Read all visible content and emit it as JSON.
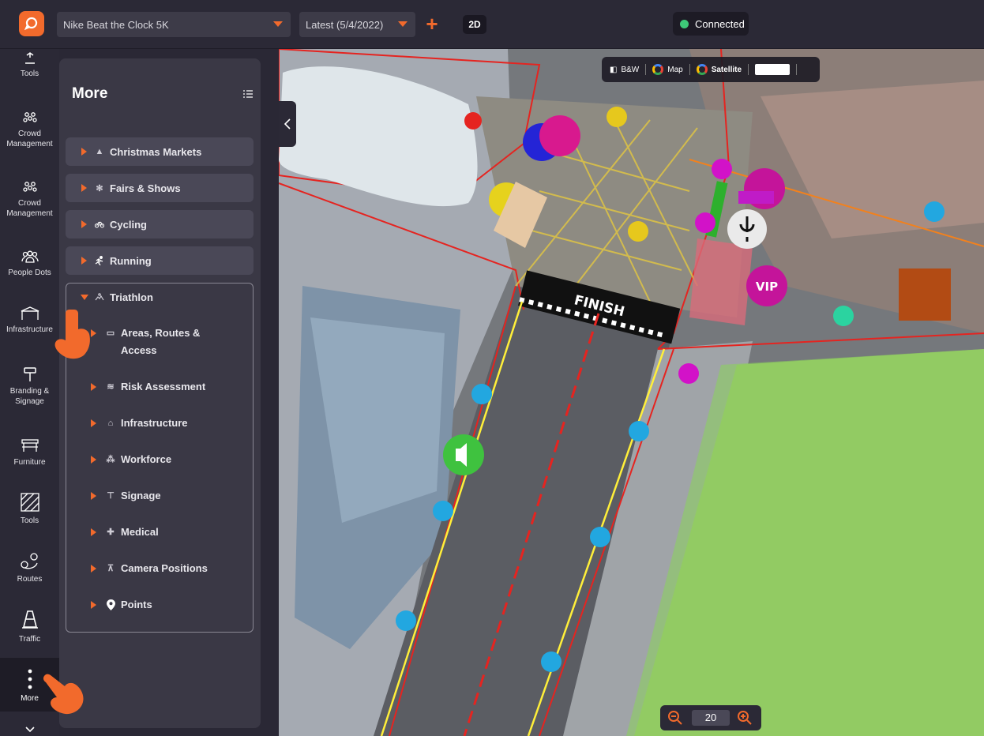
{
  "header": {
    "event_select": "Nike Beat the Clock 5K",
    "version_select": "Latest (5/4/2022)",
    "view_mode": "2D",
    "status": "Connected"
  },
  "rail": {
    "items": [
      {
        "label": "Tools"
      },
      {
        "label": "Crowd Management"
      },
      {
        "label": "Crowd Management"
      },
      {
        "label": "People Dots"
      },
      {
        "label": "Infrastructure"
      },
      {
        "label": "Branding & Signage"
      },
      {
        "label": "Furniture"
      },
      {
        "label": "Tools"
      },
      {
        "label": "Routes"
      },
      {
        "label": "Traffic"
      },
      {
        "label": "More"
      }
    ]
  },
  "panel": {
    "title": "More",
    "categories": [
      {
        "label": "Christmas Markets"
      },
      {
        "label": "Fairs & Shows"
      },
      {
        "label": "Cycling"
      },
      {
        "label": "Running"
      },
      {
        "label": "Triathlon"
      }
    ],
    "triathlon_items": [
      {
        "label": "Areas, Routes & Access"
      },
      {
        "label": "Risk Assessment"
      },
      {
        "label": "Infrastructure"
      },
      {
        "label": "Workforce"
      },
      {
        "label": "Signage"
      },
      {
        "label": "Medical"
      },
      {
        "label": "Camera Positions"
      },
      {
        "label": "Points"
      }
    ]
  },
  "map": {
    "layers": {
      "bw": "B&W",
      "map": "Map",
      "satellite": "Satellite"
    },
    "finish_banner": "FINISH",
    "vip_label": "VIP",
    "zoom_level": "20"
  },
  "colors": {
    "accent": "#f26a2c",
    "connected": "#3ec978",
    "route": "#ffef3a",
    "green_area": "#8bd35a"
  }
}
